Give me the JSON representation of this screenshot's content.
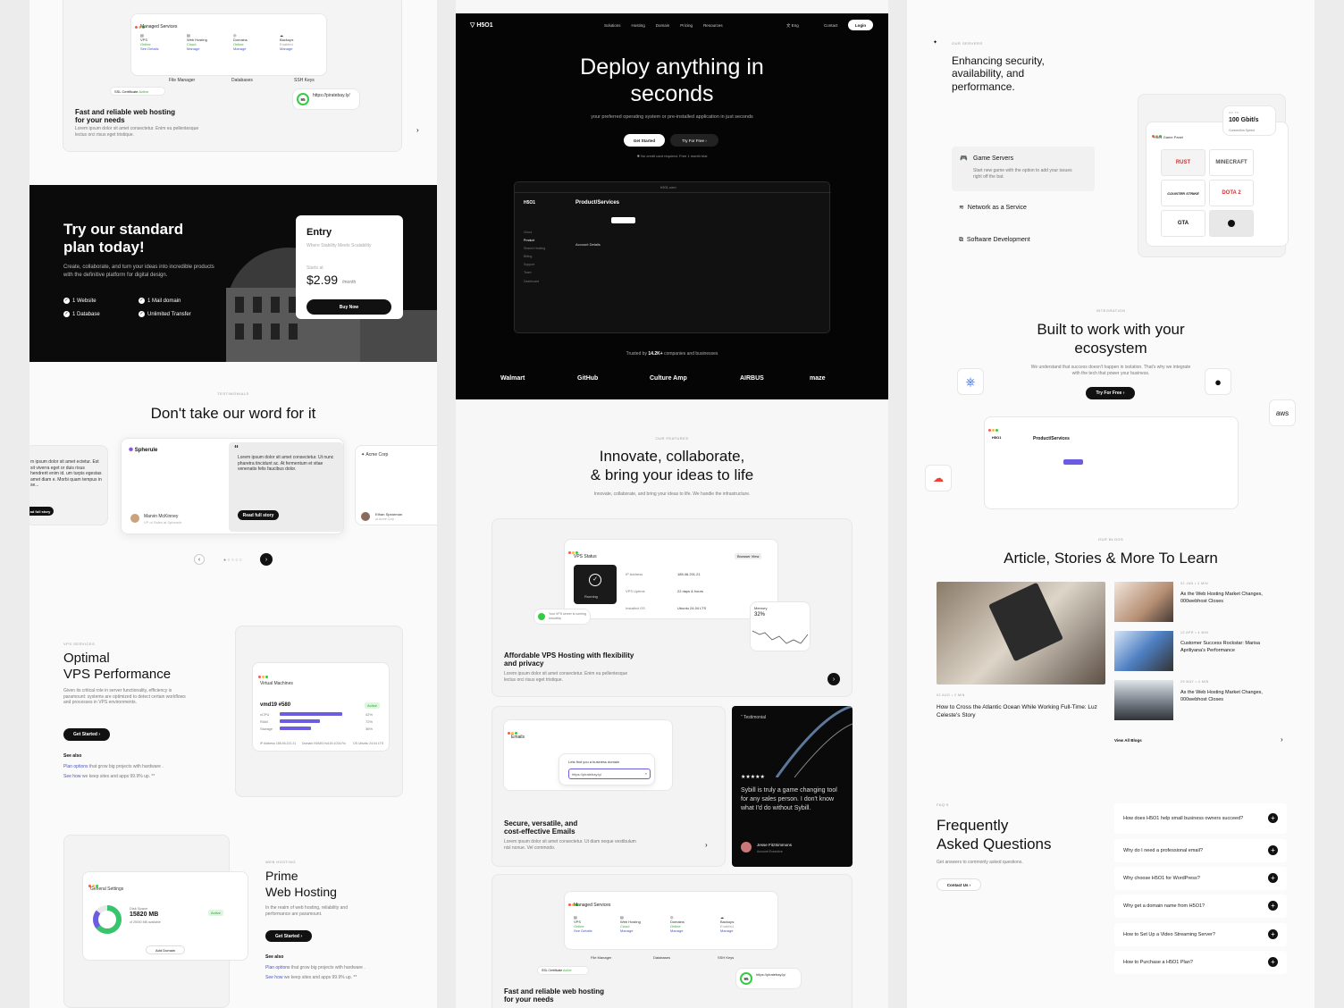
{
  "left": {
    "managed": {
      "title": "Managed Services",
      "items": [
        {
          "name": "VPS",
          "status": "Online",
          "link": "See Details"
        },
        {
          "name": "Web Hosting",
          "status": "Cloud",
          "link": "Manage"
        },
        {
          "name": "Domains",
          "status": "Online",
          "link": "Manage"
        },
        {
          "name": "Backups",
          "status": "Enabled",
          "link": "Manage"
        }
      ],
      "file_manager": "File Manager",
      "databases": "Databases",
      "ssh": "SSH Keys",
      "ssl": "SSL Certificate",
      "ssl_status": "Active",
      "url": "https://piratebay.ly/",
      "score": "95",
      "heading": "Fast and reliable web hosting for your needs",
      "body": "Lorem ipsum dolor sit amet consectetur. Enim eu pellentesque lectus orci risus eget tristique."
    },
    "plan": {
      "heading": "Try our standard plan today!",
      "body": "Create, collaborate, and turn your ideas into incredible products with the definitive platform for digital design.",
      "features": [
        "1 Website",
        "1 Mail domain",
        "1 Database",
        "Unlimited Transfer"
      ],
      "card_title": "Entry",
      "card_sub": "Where Stability Meets Scalability",
      "starts": "Starts at",
      "price": "$2.99",
      "per": "/month",
      "buy": "Buy Now"
    },
    "testimonials": {
      "eyebrow": "TESTIMONIALS",
      "heading": "Don't take our word for it",
      "left_snippet": "m ipsum dolor sit amet ectetur. Est sit viverra eget or duis risus hendrerit enim id. um turpis egestas amet diam e. Morbi quam tempus in se...",
      "left_button": "ad full story",
      "brand": "Spherule",
      "quote": "Lorem ipsum dolor sit amet consectetur. Ut nunc pharetra tincidunt ac. At fermentum et vitae venenatis felis faucibus dolor.",
      "read": "Read full story",
      "person": "Marvin McKinney",
      "role": "VP of Sales at Spherule",
      "right_brand": "Acme Corp",
      "right_person": "Ethan Spearman",
      "right_role": "at Acme Corp"
    },
    "vps": {
      "eyebrow": "VPS SERVICES",
      "heading1": "Optimal",
      "heading2": "VPS Performance",
      "body": "Given its critical role in server functionality, efficiency is paramount: systems are optimized to detect certain workflows and processes in VPS environments.",
      "cta": "Get Started",
      "see_also": "See also",
      "link1a": "Plan options",
      "link1b": " that grow big projects with hardware .",
      "link2a": "See how",
      "link2b": " we keep sites and apps 99.9% up. **",
      "vm_title": "Virtual Machines",
      "vm_name": "vmd19 #580",
      "vm_status": "Active",
      "rows": [
        {
          "label": "vCPU",
          "pct": "42%"
        },
        {
          "label": "RAM",
          "pct": "72%"
        },
        {
          "label": "Storage",
          "pct": "36%"
        }
      ],
      "ip": "IP Address 185.46.221.21",
      "domain": "Domain H2649.Ho100.1024.Ro",
      "os": "OS Ubuntu 24.04 LTS"
    },
    "webhosting": {
      "eyebrow": "WEB HOSTING",
      "heading1": "Prime",
      "heading2": "Web Hosting",
      "body": "In the realm of web hosting, reliability and performance are paramount.",
      "cta": "Get Started",
      "see_also": "See also",
      "link1a": "Plan options",
      "link1b": " that grow big projects with hardware .",
      "link2a": "See how",
      "link2b": " we keep sites and apps 99.9% up. **",
      "settings": "General Settings",
      "disk_label": "Disk Space",
      "disk": "15820 MB",
      "disk_of": "of 25000 MB available",
      "active": "Active",
      "add_domain": "Add Domain"
    }
  },
  "center": {
    "nav": {
      "brand": "H5O1",
      "links": [
        "Solutions",
        "Hosting",
        "Domain",
        "Pricing",
        "Resources"
      ],
      "lang": "Eng",
      "contact": "Contact",
      "login": "Login"
    },
    "hero": {
      "title1": "Deploy anything in",
      "title2": "seconds",
      "sub": "your preferred operating system or pre-installed application in just seconds",
      "cta": "Get Started",
      "cta2": "Try For Free",
      "note": "No credit card required. Free 1 month trial"
    },
    "dash": {
      "title": "Product/Services",
      "brand": "H5O1",
      "account": "Account Details",
      "url": "h501.com",
      "sidebar": [
        "Cloud",
        "Product",
        "Shared Hosting",
        "Billing",
        "Support",
        "Team",
        "Dashboard"
      ]
    },
    "trusted": {
      "pre": "Trusted by ",
      "count": "14.2K+",
      "post": " companies and businesses"
    },
    "logos": [
      "Walmart",
      "GitHub",
      "Culture Amp",
      "AIRBUS",
      "maze"
    ],
    "features": {
      "eyebrow": "OUR FEATURES",
      "heading1": "Innovate, collaborate,",
      "heading2": "& bring your ideas to life",
      "sub": "Innovate, collaborate, and bring your ideas to life. We handle the infrastructure."
    },
    "vps_card": {
      "title": "VPS Status",
      "browser": "Browser View",
      "running": "Running",
      "ip_label": "IP Address",
      "ip": "185.46.201.21",
      "up_label": "VPS Uptime",
      "up": "22 days & hours",
      "os_label": "Installed OS",
      "os": "Ubuntu 24.04 LTS",
      "memory": "Memory",
      "mem_pct": "32%",
      "toast": "Your VPS server is running smoothly",
      "heading": "Affordable VPS Hosting with flexibility and privacy",
      "body": "Lorem ipsum dolor sit amet consectetur. Enim eu pellentesque lectus orci risus eget tristique."
    },
    "email_card": {
      "title": "Emails",
      "find": "Lets find you a business domain",
      "input": "https://piratebay.ly/",
      "heading": "Secure, versatile, and cost-effective Emails",
      "body": "Lorem ipsum dolor sit amet consectetur. Ut diam neque vestibulum nisl nonue. Vel commodo."
    },
    "testimonial": {
      "label": "Testimonial",
      "stars": "★★★★★",
      "quote": "Sybill is truly a game changing tool for any sales person. I don't know what I'd do without Sybill.",
      "person": "Jesse FitzSimmons",
      "role": "Account Executive"
    },
    "managed": {
      "title": "Managed Services",
      "items": [
        {
          "name": "VPS",
          "status": "Online",
          "link": "See Details"
        },
        {
          "name": "Web Hosting",
          "status": "Cloud",
          "link": "Manage"
        },
        {
          "name": "Domains",
          "status": "Online",
          "link": "Manage"
        },
        {
          "name": "Backups",
          "status": "Enabled",
          "link": "Manage"
        }
      ],
      "file_manager": "File Manager",
      "databases": "Databases",
      "ssh": "SSH Keys",
      "ssl": "SSL Certificate",
      "ssl_status": "Active",
      "url": "https://piratebay.ly/",
      "score": "95",
      "heading": "Fast and reliable web hosting for your needs"
    }
  },
  "right": {
    "servers": {
      "eyebrow": "OUR SERVERS",
      "heading": "Enhancing security, availability, and performance.",
      "items": [
        {
          "title": "Game Servers",
          "body": "Start new game with the option to add your issues right off the bat."
        },
        {
          "title": "Network as a Service"
        },
        {
          "title": "Software Development"
        }
      ],
      "speed_label": "UP TO",
      "speed": "100 Gbit/s",
      "speed_sub": "Connection Speed",
      "panel": "H501 Game Panel",
      "games": [
        "RUST",
        "MINECRAFT",
        "COUNTER STRIKE",
        "DOTA 2",
        "GTA"
      ]
    },
    "integration": {
      "eyebrow": "INTEGRATION",
      "heading1": "Built to work with your",
      "heading2": "ecosystem",
      "body": "We understand that success doesn't happen in isolation. That's why we integrate with the tech that power your business.",
      "cta": "Try For Free",
      "aws": "aws",
      "dash_title": "Product/Services",
      "dash_brand": "H5O1"
    },
    "blogs": {
      "eyebrow": "OUR BLOGS",
      "heading": "Article, Stories & More To Learn",
      "main_meta": "02 AUG • 2 MIN",
      "main_title": "How to Cross the Atlantic Ocean While Working Full-Time: Luz Celeste's Story",
      "items": [
        {
          "meta": "02 JAN • 3 MIN",
          "title": "As the Web Hosting Market Changes, 000webhost Closes"
        },
        {
          "meta": "12 APR • 4 MIN",
          "title": "Customer Success Rockstar: Marisa Apriliyana's Performance"
        },
        {
          "meta": "29 MAY • 4 MIN",
          "title": "As the Web Hosting Market Changes, 000webhost Closes"
        }
      ],
      "view_all": "View All Blogs"
    },
    "faq": {
      "eyebrow": "FAQ'S",
      "heading1": "Frequently",
      "heading2": "Asked Questions",
      "sub": "Get answers to commonly asked questions.",
      "contact": "Contact Us",
      "items": [
        "How does H5O1 help small business owners succeed?",
        "Why do I need a professional email?",
        "Why choose H5O1 for WordPress?",
        "Why get a domain name from H5O1?",
        "How to Set Up a Video Streaming Server?",
        "How to Purchase a H5O1 Plan?"
      ]
    }
  }
}
